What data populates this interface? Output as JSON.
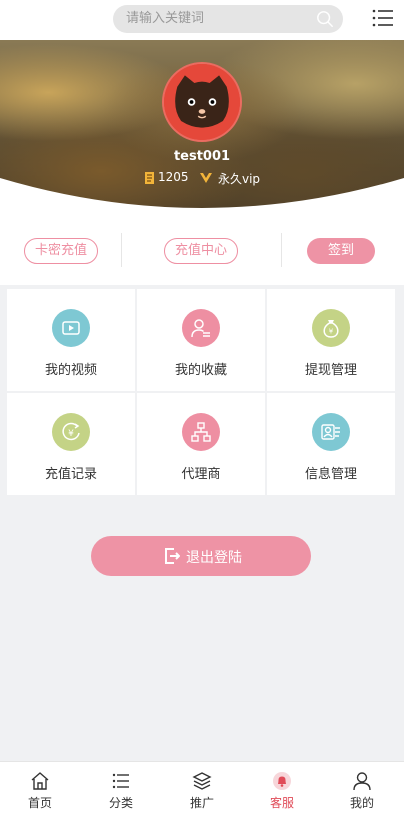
{
  "search": {
    "placeholder": "请输入关键词",
    "icon": "search-icon"
  },
  "header": {
    "menu_icon": "list-menu-icon"
  },
  "profile": {
    "username": "test001",
    "coins": "1205",
    "vip_label": "永久vip",
    "coin_icon": "coin-icon",
    "vip_icon": "vip-icon"
  },
  "actions": {
    "card_recharge": "卡密充值",
    "recharge_center": "充值中心",
    "sign_in": "签到"
  },
  "grid": [
    {
      "label": "我的视频",
      "icon": "video-icon",
      "color": "#7ec8d3"
    },
    {
      "label": "我的收藏",
      "icon": "user-favorite-icon",
      "color": "#ee8fa2"
    },
    {
      "label": "提现管理",
      "icon": "money-bag-icon",
      "color": "#c4d386"
    },
    {
      "label": "充值记录",
      "icon": "recharge-record-icon",
      "color": "#c4d386"
    },
    {
      "label": "代理商",
      "icon": "agent-network-icon",
      "color": "#ee8fa2"
    },
    {
      "label": "信息管理",
      "icon": "user-info-icon",
      "color": "#7ec8d3"
    }
  ],
  "logout": {
    "label": "退出登陆",
    "icon": "logout-icon"
  },
  "tabs": [
    {
      "label": "首页",
      "icon": "home-icon"
    },
    {
      "label": "分类",
      "icon": "category-list-icon"
    },
    {
      "label": "推广",
      "icon": "layers-icon"
    },
    {
      "label": "客服",
      "icon": "bell-icon",
      "active": true
    },
    {
      "label": "我的",
      "icon": "user-icon"
    }
  ],
  "colors": {
    "accent_pink": "#ee93a5",
    "outline_pink": "#ee8fa2",
    "active_tab": "#e04b58",
    "background": "#f0f1f3"
  }
}
